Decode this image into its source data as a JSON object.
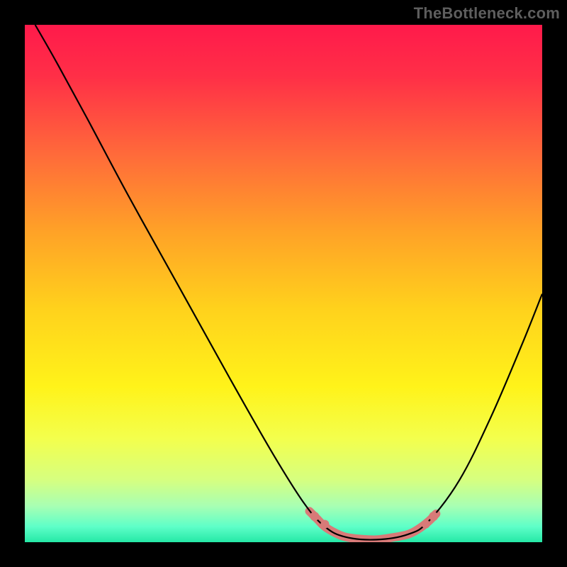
{
  "watermark": "TheBottleneck.com",
  "chart_data": {
    "type": "line",
    "title": "",
    "xlabel": "",
    "ylabel": "",
    "xlim": [
      0,
      100
    ],
    "ylim": [
      0,
      100
    ],
    "grid": false,
    "legend": false,
    "background_gradient_stops": [
      {
        "offset": 0.0,
        "color": "#ff1a4b"
      },
      {
        "offset": 0.1,
        "color": "#ff2f47"
      },
      {
        "offset": 0.25,
        "color": "#ff6a3a"
      },
      {
        "offset": 0.4,
        "color": "#ffa227"
      },
      {
        "offset": 0.55,
        "color": "#ffd21c"
      },
      {
        "offset": 0.7,
        "color": "#fff31a"
      },
      {
        "offset": 0.8,
        "color": "#f3ff4d"
      },
      {
        "offset": 0.88,
        "color": "#d6ff80"
      },
      {
        "offset": 0.93,
        "color": "#a8ffb3"
      },
      {
        "offset": 0.97,
        "color": "#5effc8"
      },
      {
        "offset": 1.0,
        "color": "#25e8a6"
      }
    ],
    "series": [
      {
        "name": "bottleneck-curve",
        "stroke": "#000000",
        "stroke_width": 2.2,
        "points": [
          {
            "x": 2.0,
            "y": 100.0
          },
          {
            "x": 6.0,
            "y": 93.0
          },
          {
            "x": 12.0,
            "y": 82.0
          },
          {
            "x": 20.0,
            "y": 67.0
          },
          {
            "x": 30.0,
            "y": 49.0
          },
          {
            "x": 40.0,
            "y": 31.0
          },
          {
            "x": 48.0,
            "y": 17.0
          },
          {
            "x": 54.0,
            "y": 7.5
          },
          {
            "x": 58.0,
            "y": 3.0
          },
          {
            "x": 62.0,
            "y": 1.0
          },
          {
            "x": 68.0,
            "y": 0.5
          },
          {
            "x": 74.0,
            "y": 1.5
          },
          {
            "x": 78.0,
            "y": 4.0
          },
          {
            "x": 84.0,
            "y": 12.0
          },
          {
            "x": 90.0,
            "y": 24.0
          },
          {
            "x": 96.0,
            "y": 38.0
          },
          {
            "x": 100.0,
            "y": 48.0
          }
        ]
      },
      {
        "name": "highlight-band",
        "stroke": "#d87a78",
        "stroke_width": 12,
        "linecap": "round",
        "points": [
          {
            "x": 55.0,
            "y": 6.0
          },
          {
            "x": 56.5,
            "y": 4.5
          },
          {
            "x": 58.0,
            "y": 3.0
          },
          {
            "x": 60.0,
            "y": 1.8
          },
          {
            "x": 62.0,
            "y": 1.0
          },
          {
            "x": 65.0,
            "y": 0.6
          },
          {
            "x": 68.0,
            "y": 0.5
          },
          {
            "x": 71.0,
            "y": 0.9
          },
          {
            "x": 74.0,
            "y": 1.5
          },
          {
            "x": 76.0,
            "y": 2.5
          },
          {
            "x": 78.0,
            "y": 4.0
          },
          {
            "x": 79.5,
            "y": 5.5
          }
        ]
      }
    ],
    "markers": [
      {
        "x": 56.0,
        "y": 5.0,
        "r": 6.5,
        "fill": "#d87a78"
      },
      {
        "x": 58.0,
        "y": 3.5,
        "r": 6.0,
        "fill": "#d87a78"
      },
      {
        "x": 77.5,
        "y": 3.5,
        "r": 6.0,
        "fill": "#d87a78"
      },
      {
        "x": 79.0,
        "y": 5.0,
        "r": 6.5,
        "fill": "#d87a78"
      }
    ]
  }
}
